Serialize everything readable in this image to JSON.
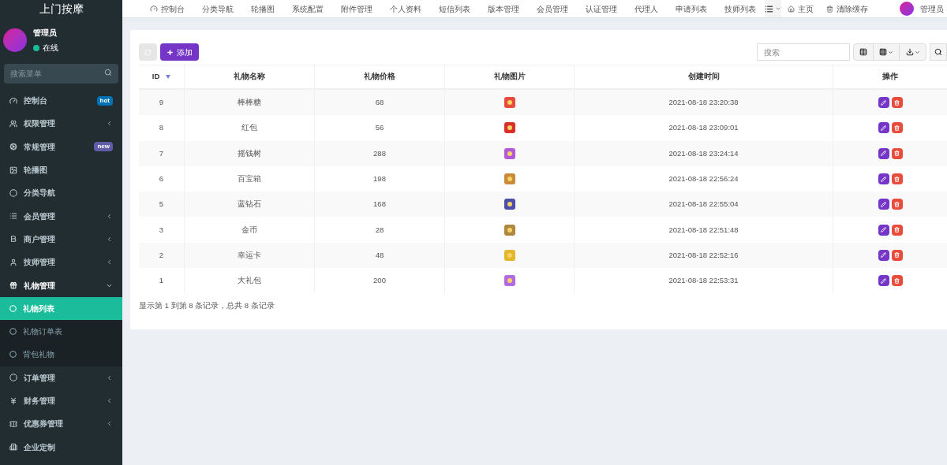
{
  "sidebar": {
    "brand": "上门按摩",
    "user": {
      "name": "管理员",
      "status": "在线",
      "online": true
    },
    "search": {
      "placeholder": "搜索菜单"
    },
    "items": [
      {
        "label": "控制台",
        "badge": {
          "text": "hot",
          "color": "#0073b7"
        },
        "has_submenu": false,
        "expanded": false,
        "selected": false
      },
      {
        "label": "权限管理",
        "has_submenu": true,
        "expanded": false,
        "selected": false
      },
      {
        "label": "常规管理",
        "badge": {
          "text": "new",
          "color": "#605ca8"
        },
        "has_submenu": false,
        "expanded": false,
        "selected": false
      },
      {
        "label": "轮播图",
        "has_submenu": false,
        "expanded": false,
        "selected": false
      },
      {
        "label": "分类导航",
        "has_submenu": false,
        "expanded": false,
        "selected": false
      },
      {
        "label": "会员管理",
        "has_submenu": true,
        "expanded": false,
        "selected": false
      },
      {
        "label": "商户管理",
        "has_submenu": true,
        "expanded": false,
        "selected": false
      },
      {
        "label": "技师管理",
        "has_submenu": true,
        "expanded": false,
        "selected": false
      },
      {
        "label": "礼物管理",
        "has_submenu": true,
        "expanded": true,
        "selected": false,
        "children": [
          {
            "label": "礼物列表",
            "selected": true
          },
          {
            "label": "礼物订单表",
            "selected": false
          },
          {
            "label": "背包礼物",
            "selected": false
          }
        ]
      },
      {
        "label": "订单管理",
        "has_submenu": true,
        "expanded": false,
        "selected": false
      },
      {
        "label": "财务管理",
        "has_submenu": true,
        "expanded": false,
        "selected": false
      },
      {
        "label": "优惠券管理",
        "has_submenu": true,
        "expanded": false,
        "selected": false
      },
      {
        "label": "企业定制",
        "has_submenu": false,
        "expanded": false,
        "selected": false
      }
    ]
  },
  "topnav": {
    "tabs": [
      "控制台",
      "分类导航",
      "轮播图",
      "系统配置",
      "附件管理",
      "个人资料",
      "短信列表",
      "版本管理",
      "会员管理",
      "认证管理",
      "代理人",
      "申请列表",
      "技师列表"
    ],
    "home": "主页",
    "clear_cache": "清除缓存",
    "user": "管理员"
  },
  "toolbar": {
    "add": "添加",
    "search": {
      "placeholder": "搜索"
    }
  },
  "table": {
    "columns": [
      "ID",
      "礼物名称",
      "礼物价格",
      "礼物图片",
      "创建时间",
      "操作"
    ],
    "rows": [
      {
        "id": "9",
        "name": "棒棒糖",
        "price": "68",
        "time": "2021-08-18 23:20:38"
      },
      {
        "id": "8",
        "name": "红包",
        "price": "56",
        "time": "2021-08-18 23:09:01"
      },
      {
        "id": "7",
        "name": "摇钱树",
        "price": "288",
        "time": "2021-08-18 23:24:14"
      },
      {
        "id": "6",
        "name": "百宝箱",
        "price": "198",
        "time": "2021-08-18 22:56:24"
      },
      {
        "id": "5",
        "name": "蓝钻石",
        "price": "168",
        "time": "2021-08-18 22:55:04"
      },
      {
        "id": "3",
        "name": "金币",
        "price": "28",
        "time": "2021-08-18 22:51:48"
      },
      {
        "id": "2",
        "name": "幸运卡",
        "price": "48",
        "time": "2021-08-18 22:52:16"
      },
      {
        "id": "1",
        "name": "大礼包",
        "price": "200",
        "time": "2021-08-18 22:53:31"
      }
    ],
    "summary": "显示第 1 到第 8 条记录，总共 8 条记录"
  }
}
